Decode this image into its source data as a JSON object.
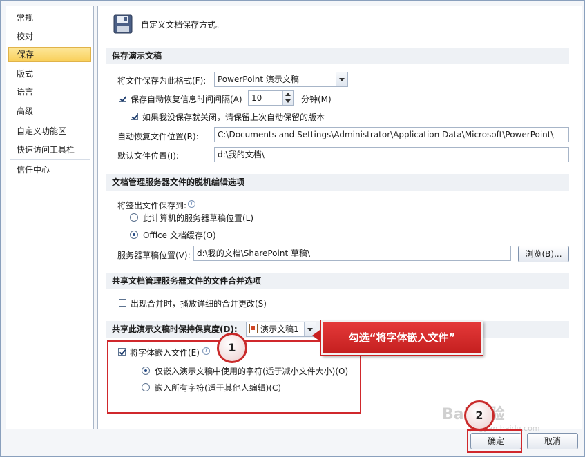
{
  "nav": {
    "items": [
      "常规",
      "校对",
      "保存",
      "版式",
      "语言",
      "高级",
      "自定义功能区",
      "快速访问工具栏",
      "信任中心"
    ],
    "active_index": 2
  },
  "header": {
    "title": "自定义文档保存方式。"
  },
  "save_section": {
    "heading": "保存演示文稿",
    "format_label": "将文件保存为此格式(F):",
    "format_value": "PowerPoint 演示文稿",
    "autorecover_label": "保存自动恢复信息时间间隔(A)",
    "autorecover_checked": true,
    "interval_value": "10",
    "minutes_label": "分钟(M)",
    "keep_last_label": "如果我没保存就关闭，请保留上次自动保留的版本",
    "keep_last_checked": true,
    "autorecover_location_label": "自动恢复文件位置(R):",
    "autorecover_location_value": "C:\\Documents and Settings\\Administrator\\Application Data\\Microsoft\\PowerPoint\\",
    "default_location_label": "默认文件位置(I):",
    "default_location_value": "d:\\我的文档\\"
  },
  "offline_section": {
    "heading": "文档管理服务器文件的脱机编辑选项",
    "save_checkout_label": "将签出文件保存到:",
    "option_server": "此计算机的服务器草稿位置(L)",
    "option_office": "Office 文档缓存(O)",
    "selected": "option_office",
    "drafts_label": "服务器草稿位置(V):",
    "drafts_value": "d:\\我的文档\\SharePoint 草稿\\",
    "browse_label": "浏览(B)..."
  },
  "merge_section": {
    "heading": "共享文档管理服务器文件的文件合并选项",
    "show_details_label": "出现合并时，播放详细的合并更改(S)",
    "show_details_checked": false
  },
  "fidelity_section": {
    "heading": "共享此演示文稿时保持保真度(D):",
    "presentation_value": "演示文稿1",
    "embed_fonts_label": "将字体嵌入文件(E)",
    "embed_fonts_checked": true,
    "option_used_chars": "仅嵌入演示文稿中使用的字符(适于减小文件大小)(O)",
    "option_all_chars": "嵌入所有字符(适于其他人编辑)(C)",
    "selected": "option_used_chars"
  },
  "annotations": {
    "callout_text": "勾选“将字体嵌入文件”",
    "step1": "1",
    "step2": "2"
  },
  "footer": {
    "ok_label": "确定",
    "cancel_label": "取消"
  },
  "watermark": {
    "text": "Bai 经验",
    "subtext": "jingyan.baidu.com"
  },
  "colors": {
    "accent_red": "#d0282c",
    "nav_active": "#f9cf59"
  }
}
